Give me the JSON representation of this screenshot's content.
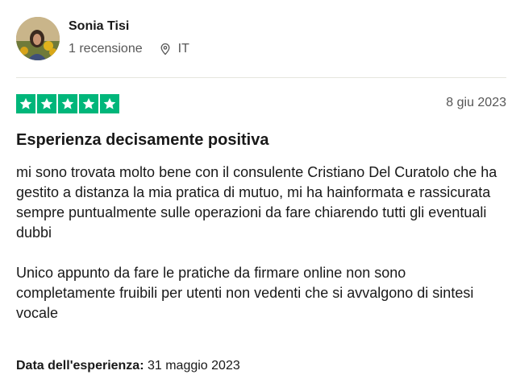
{
  "reviewer": {
    "name": "Sonia Tisi",
    "review_count": "1 recensione",
    "country": "IT"
  },
  "icons": {
    "location": "location-pin-icon",
    "star": "star-icon"
  },
  "colors": {
    "star_bg": "#00b67a",
    "muted_text": "#575757",
    "divider": "#e5e5dd"
  },
  "rating": {
    "stars": 5,
    "max": 5
  },
  "review": {
    "date": "8 giu 2023",
    "title": "Esperienza decisamente positiva",
    "paragraphs": [
      "mi sono trovata molto bene con il consulente Cristiano Del Curatolo che ha gestito a distanza la mia pratica di mutuo, mi ha hainformata e rassicurata sempre puntualmente sulle operazioni da fare chiarendo tutti gli eventuali dubbi",
      "Unico appunto da fare le pratiche da firmare online non sono completamente fruibili per utenti non vedenti che si avvalgono di sintesi vocale"
    ],
    "experience_label": "Data dell'esperienza:",
    "experience_date": "31 maggio 2023"
  }
}
